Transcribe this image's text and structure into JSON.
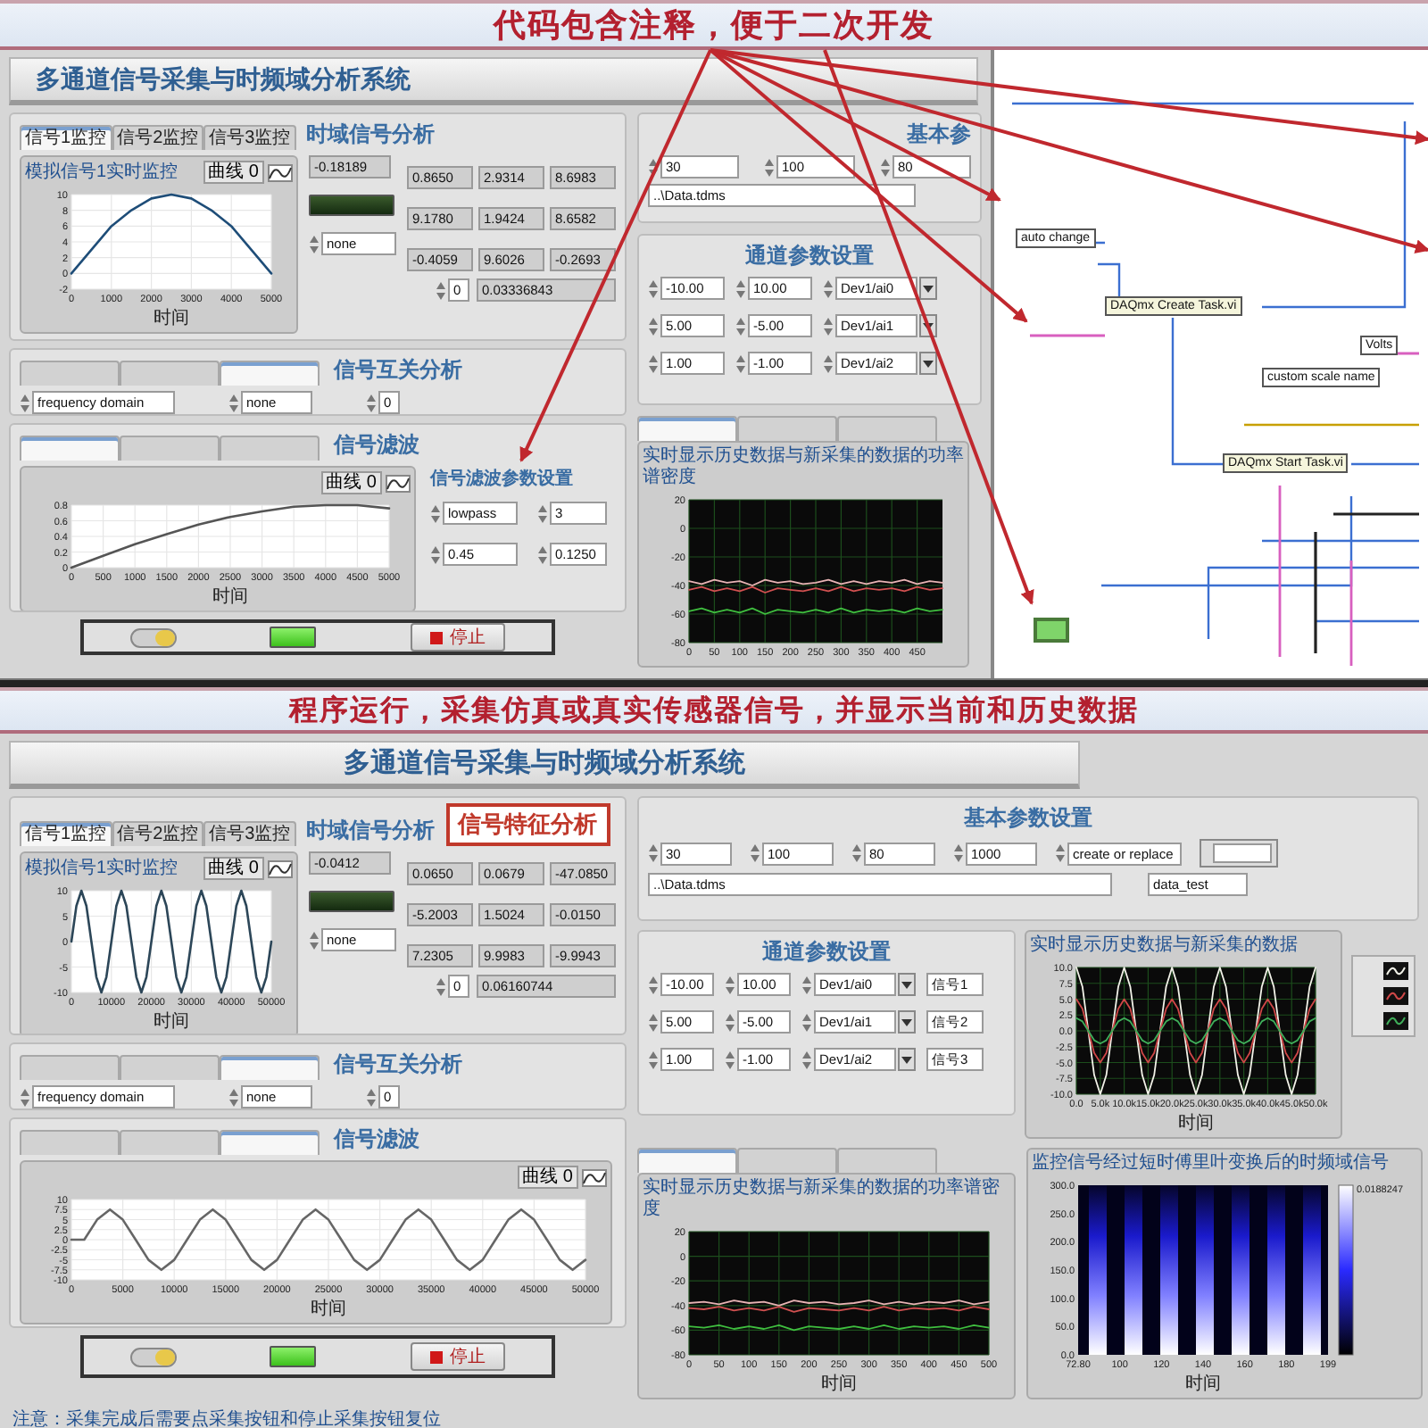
{
  "top": {
    "banner": "代码包含注释，便于二次开发",
    "panel": {
      "title": "多通道信号采集与时频域分析系统",
      "time": {
        "tabs": [
          {
            "label": "信号1监控",
            "selected": true
          },
          {
            "label": "信号2监控",
            "selected": false
          },
          {
            "label": "信号3监控",
            "selected": false
          }
        ],
        "heading": "时域信号分析",
        "chart": {
          "title": "模拟信号1实时监控",
          "chart_data": {
            "type": "line",
            "grid": true,
            "xlabel": "时间",
            "x": [
              0,
              500,
              1000,
              1500,
              2000,
              2500,
              3000,
              3500,
              4000,
              4500,
              5000
            ],
            "xlim": [
              0,
              5000
            ],
            "ylim": [
              -2,
              10
            ],
            "xticks": [
              0,
              1000,
              2000,
              3000,
              4000,
              5000
            ],
            "yticks": [
              10,
              8,
              6,
              4,
              2,
              0,
              -2
            ],
            "series": [
              {
                "name": "曲线 0",
                "color": "#1e4d78",
                "values": [
                  0,
                  3,
                  6,
                  8,
                  9.5,
                  10,
                  9.5,
                  8,
                  6,
                  3,
                  0
                ]
              }
            ]
          }
        },
        "current_value": "-0.18189",
        "alarm_on": false,
        "stats": [
          "0.8650",
          "2.9314",
          "8.6983",
          "9.1780",
          "1.9424",
          "8.6582",
          "-0.4059",
          "9.6026",
          "-0.2693"
        ],
        "scale": "none",
        "index": "0",
        "timestamp": "0.03336843"
      },
      "correlation": {
        "tabs": [
          {
            "selected": false
          },
          {
            "selected": false
          },
          {
            "selected": true
          }
        ],
        "heading": "信号互关分析",
        "method": "frequency domain",
        "scale": "none",
        "index": "0"
      },
      "filter": {
        "tabs": [
          {
            "selected": true
          },
          {
            "selected": false
          },
          {
            "selected": false
          }
        ],
        "heading": "信号滤波",
        "chart": {
          "chart_data": {
            "type": "line",
            "grid": true,
            "xlabel": "时间",
            "x": [
              0,
              500,
              1000,
              1500,
              2000,
              2500,
              3000,
              3500,
              4000,
              4500,
              5000
            ],
            "xlim": [
              0,
              5000
            ],
            "ylim": [
              0,
              0.8
            ],
            "xticks": [
              0,
              500,
              1000,
              1500,
              2000,
              2500,
              3000,
              3500,
              4000,
              4500,
              5000
            ],
            "yticks": [
              0.8,
              0.6,
              0.4,
              0.2,
              0
            ],
            "series": [
              {
                "name": "曲线 0",
                "color": "#555555",
                "values": [
                  0,
                  0.15,
                  0.3,
                  0.43,
                  0.55,
                  0.65,
                  0.72,
                  0.78,
                  0.8,
                  0.8,
                  0.76
                ]
              }
            ]
          }
        },
        "params": {
          "heading": "信号滤波参数设置",
          "values": [
            "lowpass",
            "3",
            "0.45",
            "0.1250"
          ]
        }
      },
      "controls": {
        "acquire_on": true,
        "indicator_on": true,
        "stop": "停止"
      },
      "basic": {
        "heading": "基本参",
        "fields": [
          "30",
          "100",
          "80"
        ],
        "path": "..\\Data.tdms"
      },
      "channels": {
        "heading": "通道参数设置",
        "rows": [
          {
            "min": "-10.00",
            "max": "10.00",
            "device": "Dev1/ai0"
          },
          {
            "min": "5.00",
            "max": "-5.00",
            "device": "Dev1/ai1"
          },
          {
            "min": "1.00",
            "max": "-1.00",
            "device": "Dev1/ai2"
          }
        ]
      },
      "psd": {
        "tabs": [
          {
            "selected": true
          },
          {
            "selected": false
          },
          {
            "selected": false
          }
        ],
        "chart": {
          "title": "实时显示历史数据与新采集的数据的功率谱密度",
          "chart_data": {
            "type": "line",
            "grid": true,
            "x": [
              0,
              25,
              50,
              75,
              100,
              125,
              150,
              175,
              200,
              225,
              250,
              275,
              300,
              325,
              350,
              375,
              400,
              425,
              450,
              475,
              500
            ],
            "xlim": [
              0,
              500
            ],
            "ylim": [
              -80,
              20
            ],
            "xticks": [
              0,
              50,
              100,
              150,
              200,
              250,
              300,
              350,
              400,
              450
            ],
            "yticks": [
              20,
              0,
              -20,
              -40,
              -60,
              -80
            ],
            "series": [
              {
                "color": "#e8b4b4",
                "values": [
                  -37,
                  -39,
                  -36,
                  -38,
                  -37,
                  -40,
                  -36,
                  -38,
                  -37,
                  -39,
                  -38,
                  -36,
                  -39,
                  -37,
                  -39,
                  -37,
                  -38,
                  -36,
                  -39,
                  -37,
                  -38
                ]
              },
              {
                "color": "#d05050",
                "values": [
                  -43,
                  -41,
                  -44,
                  -42,
                  -44,
                  -41,
                  -45,
                  -42,
                  -43,
                  -44,
                  -42,
                  -44,
                  -41,
                  -44,
                  -42,
                  -43,
                  -42,
                  -44,
                  -41,
                  -43,
                  -42
                ]
              },
              {
                "color": "#3fbf3f",
                "values": [
                  -58,
                  -56,
                  -59,
                  -57,
                  -59,
                  -56,
                  -60,
                  -57,
                  -58,
                  -59,
                  -57,
                  -59,
                  -56,
                  -59,
                  -57,
                  -58,
                  -57,
                  -59,
                  -56,
                  -58,
                  -57
                ]
              }
            ]
          }
        }
      }
    },
    "diagram": {
      "nodes": [
        {
          "label": "auto change"
        },
        {
          "label": "DAQmx Create Task.vi"
        },
        {
          "label": "Volts"
        },
        {
          "label": "custom scale name"
        },
        {
          "label": "DAQmx Start Task.vi"
        }
      ],
      "indicator_on": true
    }
  },
  "bottom": {
    "banner": "程序运行，采集仿真或真实传感器信号，并显示当前和历史数据",
    "panel": {
      "title": "多通道信号采集与时频域分析系统",
      "time": {
        "tabs": [
          {
            "label": "信号1监控",
            "selected": true
          },
          {
            "label": "信号2监控",
            "selected": false
          },
          {
            "label": "信号3监控",
            "selected": false
          }
        ],
        "heading": "时域信号分析",
        "callout": "信号特征分析",
        "chart": {
          "title": "模拟信号1实时监控",
          "chart_data": {
            "type": "line",
            "grid": true,
            "xlabel": "时间",
            "x": [
              0,
              1250,
              2500,
              3750,
              5000,
              6250,
              7500,
              8750,
              10000,
              11250,
              12500,
              13750,
              15000,
              16250,
              17500,
              18750,
              20000,
              21250,
              22500,
              23750,
              25000,
              26250,
              27500,
              28750,
              30000,
              31250,
              32500,
              33750,
              35000,
              36250,
              37500,
              38750,
              40000,
              41250,
              42500,
              43750,
              45000,
              46250,
              47500,
              48750,
              50000
            ],
            "xlim": [
              0,
              50000
            ],
            "ylim": [
              -10,
              10
            ],
            "xticks": [
              0,
              10000,
              20000,
              30000,
              40000,
              50000
            ],
            "yticks": [
              10,
              5,
              0,
              -5,
              -10
            ],
            "series": [
              {
                "name": "曲线 0",
                "color": "#2c4658",
                "values": [
                  0,
                  7,
                  10,
                  7,
                  0,
                  -7,
                  -10,
                  -7,
                  0,
                  7,
                  10,
                  7,
                  0,
                  -7,
                  -10,
                  -7,
                  0,
                  7,
                  10,
                  7,
                  0,
                  -7,
                  -10,
                  -7,
                  0,
                  7,
                  10,
                  7,
                  0,
                  -7,
                  -10,
                  -7,
                  0,
                  7,
                  10,
                  7,
                  0,
                  -7,
                  -10,
                  -7,
                  0
                ]
              }
            ]
          }
        },
        "current_value": "-0.0412",
        "alarm_on": false,
        "stats": [
          "0.0650",
          "0.0679",
          "-47.0850",
          "-5.2003",
          "1.5024",
          "-0.0150",
          "7.2305",
          "9.9983",
          "-9.9943"
        ],
        "scale": "none",
        "index": "0",
        "timestamp": "0.06160744"
      },
      "correlation": {
        "tabs": [
          {
            "selected": false
          },
          {
            "selected": false
          },
          {
            "selected": true
          }
        ],
        "heading": "信号互关分析",
        "method": "frequency domain",
        "scale": "none",
        "index": "0"
      },
      "filter": {
        "tabs": [
          {
            "selected": false
          },
          {
            "selected": false
          },
          {
            "selected": true
          }
        ],
        "heading": "信号滤波",
        "chart": {
          "chart_data": {
            "type": "line",
            "grid": true,
            "xlabel": "时间",
            "x": [
              0,
              1250,
              2500,
              3750,
              5000,
              6250,
              7500,
              8750,
              10000,
              11250,
              12500,
              13750,
              15000,
              16250,
              17500,
              18750,
              20000,
              21250,
              22500,
              23750,
              25000,
              26250,
              27500,
              28750,
              30000,
              31250,
              32500,
              33750,
              35000,
              36250,
              37500,
              38750,
              40000,
              41250,
              42500,
              43750,
              45000,
              46250,
              47500,
              48750,
              50000
            ],
            "xlim": [
              0,
              50000
            ],
            "ylim": [
              -10,
              10
            ],
            "xticks": [
              0,
              5000,
              10000,
              15000,
              20000,
              25000,
              30000,
              35000,
              40000,
              45000,
              50000
            ],
            "yticks": [
              10,
              7.5,
              5,
              2.5,
              0,
              -2.5,
              -5,
              -7.5,
              -10
            ],
            "series": [
              {
                "name": "曲线 0",
                "color": "#666666",
                "values": [
                  0,
                  0,
                  5,
                  7.5,
                  5,
                  0,
                  -5,
                  -7.5,
                  -5,
                  0,
                  5,
                  7.5,
                  5,
                  0,
                  -5,
                  -7.5,
                  -5,
                  0,
                  5,
                  7.5,
                  5,
                  0,
                  -5,
                  -7.5,
                  -5,
                  0,
                  5,
                  7.5,
                  5,
                  0,
                  -5,
                  -7.5,
                  -5,
                  0,
                  5,
                  7.5,
                  5,
                  0,
                  -5,
                  -7.5,
                  -5
                ]
              }
            ]
          }
        }
      },
      "controls": {
        "acquire_on": true,
        "indicator_on": true,
        "stop": "停止"
      },
      "basic": {
        "heading": "基本参数设置",
        "fields": [
          "30",
          "100",
          "80",
          "1000",
          "create or replace"
        ],
        "path": "..\\Data.tdms",
        "group_name": "data_test"
      },
      "channels": {
        "heading": "通道参数设置",
        "rows": [
          {
            "min": "-10.00",
            "max": "10.00",
            "device": "Dev1/ai0",
            "name": "信号1"
          },
          {
            "min": "5.00",
            "max": "-5.00",
            "device": "Dev1/ai1",
            "name": "信号2"
          },
          {
            "min": "1.00",
            "max": "-1.00",
            "device": "Dev1/ai2",
            "name": "信号3"
          }
        ]
      },
      "history": {
        "title": "实时显示历史数据与新采集的数据",
        "chart_data": {
          "type": "line",
          "grid": true,
          "xlabel": "时间",
          "x": [
            0,
            1250,
            2500,
            3750,
            5000,
            6250,
            7500,
            8750,
            10000,
            11250,
            12500,
            13750,
            15000,
            16250,
            17500,
            18750,
            20000,
            21250,
            22500,
            23750,
            25000,
            26250,
            27500,
            28750,
            30000,
            31250,
            32500,
            33750,
            35000,
            36250,
            37500,
            38750,
            40000,
            41250,
            42500,
            43750,
            45000,
            46250,
            47500,
            48750,
            50000
          ],
          "xlim": [
            0,
            50000
          ],
          "ylim": [
            -10,
            10
          ],
          "xticks": [
            {
              "value": 0,
              "label": "0.0"
            },
            {
              "value": 5000,
              "label": "5.0k"
            },
            {
              "value": 10000,
              "label": "10.0k"
            },
            {
              "value": 15000,
              "label": "15.0k"
            },
            {
              "value": 20000,
              "label": "20.0k"
            },
            {
              "value": 25000,
              "label": "25.0k"
            },
            {
              "value": 30000,
              "label": "30.0k"
            },
            {
              "value": 35000,
              "label": "35.0k"
            },
            {
              "value": 40000,
              "label": "40.0k"
            },
            {
              "value": 45000,
              "label": "45.0k"
            },
            {
              "value": 50000,
              "label": "50.0k"
            }
          ],
          "yticks": [
            {
              "value": 10,
              "label": "10.0"
            },
            {
              "value": 7.5,
              "label": "7.5"
            },
            {
              "value": 5,
              "label": "5.0"
            },
            {
              "value": 2.5,
              "label": "2.5"
            },
            {
              "value": 0,
              "label": "0.0"
            },
            {
              "value": -2.5,
              "label": "-2.5"
            },
            {
              "value": -5,
              "label": "-5.0"
            },
            {
              "value": -7.5,
              "label": "-7.5"
            },
            {
              "value": -10,
              "label": "-10.0"
            }
          ],
          "series": [
            {
              "color": "#f2f2e8",
              "values": [
                10,
                7,
                0,
                -7,
                -10,
                -7,
                0,
                7,
                10,
                7,
                0,
                -7,
                -10,
                -7,
                0,
                7,
                10,
                7,
                0,
                -7,
                -10,
                -7,
                0,
                7,
                10,
                7,
                0,
                -7,
                -10,
                -7,
                0,
                7,
                10,
                7,
                0,
                -7,
                -10,
                -7,
                0,
                7,
                10
              ]
            },
            {
              "color": "#d04848",
              "values": [
                5,
                3.5,
                0,
                -3.5,
                -5,
                -3.5,
                0,
                3.5,
                5,
                3.5,
                0,
                -3.5,
                -5,
                -3.5,
                0,
                3.5,
                5,
                3.5,
                0,
                -3.5,
                -5,
                -3.5,
                0,
                3.5,
                5,
                3.5,
                0,
                -3.5,
                -5,
                -3.5,
                0,
                3.5,
                5,
                3.5,
                0,
                -3.5,
                -5,
                -3.5,
                0,
                3.5,
                5
              ]
            },
            {
              "color": "#3fae5a",
              "values": [
                2,
                1.5,
                0,
                -1.5,
                -2,
                -1.5,
                0,
                1.5,
                2,
                1.5,
                0,
                -1.5,
                -2,
                -1.5,
                0,
                1.5,
                2,
                1.5,
                0,
                -1.5,
                -2,
                -1.5,
                0,
                1.5,
                2,
                1.5,
                0,
                -1.5,
                -2,
                -1.5,
                0,
                1.5,
                2,
                1.5,
                0,
                -1.5,
                -2,
                -1.5,
                0,
                1.5,
                2
              ]
            }
          ]
        }
      },
      "psd": {
        "tabs": [
          {
            "selected": true
          },
          {
            "selected": false
          },
          {
            "selected": false
          }
        ],
        "chart": {
          "title": "实时显示历史数据与新采集的数据的功率谱密度",
          "chart_data": {
            "type": "line",
            "grid": true,
            "xlabel": "时间",
            "x": [
              0,
              25,
              50,
              75,
              100,
              125,
              150,
              175,
              200,
              225,
              250,
              275,
              300,
              325,
              350,
              375,
              400,
              425,
              450,
              475,
              500
            ],
            "xlim": [
              0,
              500
            ],
            "ylim": [
              -80,
              20
            ],
            "xticks": [
              0,
              50,
              100,
              150,
              200,
              250,
              300,
              350,
              400,
              450,
              500
            ],
            "yticks": [
              20,
              0,
              -20,
              -40,
              -60,
              -80
            ],
            "series": [
              {
                "color": "#e8b4b4",
                "values": [
                  -38,
                  -37,
                  -39,
                  -36,
                  -38,
                  -37,
                  -40,
                  -36,
                  -38,
                  -37,
                  -39,
                  -38,
                  -36,
                  -39,
                  -37,
                  -39,
                  -37,
                  -38,
                  -36,
                  -39,
                  -37
                ]
              },
              {
                "color": "#d05050",
                "values": [
                  -42,
                  -43,
                  -41,
                  -44,
                  -42,
                  -44,
                  -41,
                  -45,
                  -42,
                  -43,
                  -44,
                  -42,
                  -44,
                  -41,
                  -44,
                  -42,
                  -43,
                  -42,
                  -44,
                  -41,
                  -43
                ]
              },
              {
                "color": "#3fbf3f",
                "values": [
                  -57,
                  -58,
                  -56,
                  -59,
                  -57,
                  -59,
                  -56,
                  -60,
                  -57,
                  -58,
                  -59,
                  -57,
                  -59,
                  -56,
                  -59,
                  -57,
                  -58,
                  -57,
                  -59,
                  -56,
                  -58
                ]
              }
            ]
          }
        }
      },
      "spectrogram": {
        "title": "监控信号经过短时傅里叶变换后的时频域信号",
        "xlabel": "时间",
        "xticks": [
          "72.80",
          "100",
          "120",
          "140",
          "160",
          "180",
          "199"
        ],
        "yticks": [
          "300.0",
          "250.0",
          "200.0",
          "150.0",
          "100.0",
          "50.0",
          "0.0"
        ],
        "scale_label": "0.0188247"
      },
      "note": "注意：采集完成后需要点采集按钮和停止采集按钮复位"
    }
  }
}
